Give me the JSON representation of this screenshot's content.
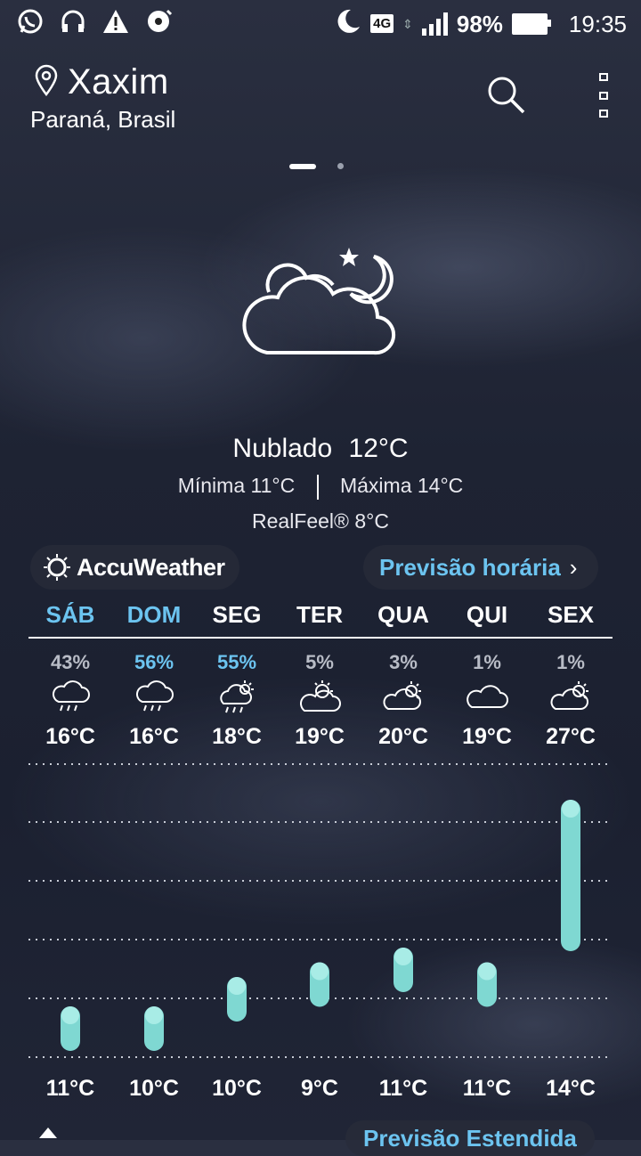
{
  "status_bar": {
    "left_icons": [
      "whatsapp-icon",
      "headset-icon",
      "warning-icon",
      "media-icon"
    ],
    "network": "4G",
    "battery": "98%",
    "time": "19:35"
  },
  "header": {
    "city": "Xaxim",
    "region": "Paraná, Brasil"
  },
  "current": {
    "condition": "Nublado",
    "temp": "12°C",
    "min": "Mínima 11°C",
    "max": "Máxima 14°C",
    "realfeel": "RealFeel® 8°C",
    "icon": "cloud-night-icon"
  },
  "brand": {
    "name": "AccuWeather"
  },
  "hourly_link": {
    "label": "Previsão horária",
    "arrow": "›"
  },
  "forecast": {
    "days": [
      {
        "name": "SÁB",
        "precip": "43%",
        "max": "16°C",
        "min": "11°C",
        "icon": "rain-icon"
      },
      {
        "name": "DOM",
        "precip": "56%",
        "max": "16°C",
        "min": "10°C",
        "icon": "rain-icon"
      },
      {
        "name": "SEG",
        "precip": "55%",
        "max": "18°C",
        "min": "10°C",
        "icon": "sun-rain-icon"
      },
      {
        "name": "TER",
        "precip": "5%",
        "max": "19°C",
        "min": "9°C",
        "icon": "partly-cloudy-icon"
      },
      {
        "name": "QUA",
        "precip": "3%",
        "max": "20°C",
        "min": "11°C",
        "icon": "partly-sunny-icon"
      },
      {
        "name": "QUI",
        "precip": "1%",
        "max": "19°C",
        "min": "11°C",
        "icon": "cloud-icon"
      },
      {
        "name": "SEX",
        "precip": "1%",
        "max": "27°C",
        "min": "14°C",
        "icon": "partly-sunny-icon"
      }
    ],
    "colors": {
      "highlight_day": "#6cc4f0",
      "normal_day": "#ffffff",
      "precip_high": "#6cc4f0",
      "precip_low": "#b8bcc6",
      "bar": "#7fd8d2",
      "bar_cap": "#a8ece6"
    }
  },
  "chart_data": {
    "type": "bar",
    "categories": [
      "SÁB",
      "DOM",
      "SEG",
      "TER",
      "QUA",
      "QUI",
      "SEX"
    ],
    "series": [
      {
        "values_low": [
          11,
          10,
          10,
          9,
          11,
          11,
          14
        ],
        "values_high": [
          16,
          16,
          18,
          19,
          20,
          19,
          27
        ]
      }
    ],
    "bar_level_estimates": {
      "top_rank": [
        0.55,
        0.55,
        0.65,
        0.7,
        0.75,
        0.7,
        1.0
      ]
    }
  },
  "extended_link": {
    "label": "Previsão Estendida"
  }
}
